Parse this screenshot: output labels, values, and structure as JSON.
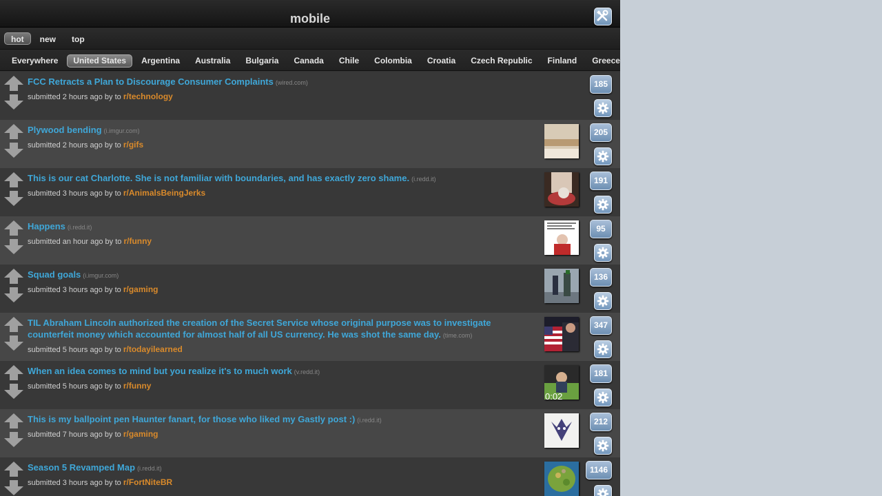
{
  "header": {
    "title": "mobile",
    "tools_icon": "tools-icon"
  },
  "sort_tabs": [
    {
      "label": "hot",
      "active": true
    },
    {
      "label": "new",
      "active": false
    },
    {
      "label": "top",
      "active": false
    }
  ],
  "countries": [
    {
      "label": "Everywhere",
      "active": false
    },
    {
      "label": "United States",
      "active": true
    },
    {
      "label": "Argentina",
      "active": false
    },
    {
      "label": "Australia",
      "active": false
    },
    {
      "label": "Bulgaria",
      "active": false
    },
    {
      "label": "Canada",
      "active": false
    },
    {
      "label": "Chile",
      "active": false
    },
    {
      "label": "Colombia",
      "active": false
    },
    {
      "label": "Croatia",
      "active": false
    },
    {
      "label": "Czech Republic",
      "active": false
    },
    {
      "label": "Finland",
      "active": false
    },
    {
      "label": "Greece",
      "active": false
    }
  ],
  "posts": [
    {
      "title": "FCC Retracts a Plan to Discourage Consumer Complaints",
      "domain": "(wired.com)",
      "meta": "submitted 2 hours ago  by to",
      "subreddit": "r/technology",
      "score": "185",
      "thumb": ""
    },
    {
      "title": "Plywood bending",
      "domain": "(i.imgur.com)",
      "meta": "submitted 2 hours ago  by to",
      "subreddit": "r/gifs",
      "score": "205",
      "thumb": "wood"
    },
    {
      "title": "This is our cat Charlotte. She is not familiar with boundaries, and has exactly zero shame.",
      "domain": "(i.redd.it)",
      "meta": "submitted 3 hours ago  by to",
      "subreddit": "r/AnimalsBeingJerks",
      "score": "191",
      "thumb": "cat"
    },
    {
      "title": "Happens",
      "domain": "(i.redd.it)",
      "meta": "submitted an hour ago  by to",
      "subreddit": "r/funny",
      "score": "95",
      "thumb": "meme"
    },
    {
      "title": "Squad goals",
      "domain": "(i.imgur.com)",
      "meta": "submitted 3 hours ago  by to",
      "subreddit": "r/gaming",
      "score": "136",
      "thumb": "squad"
    },
    {
      "title": "TIL Abraham Lincoln authorized the creation of the Secret Service whose original purpose was to investigate counterfeit money which accounted for almost half of all US currency. He was shot the same day.",
      "domain": "(time.com)",
      "meta": "submitted 5 hours ago  by to",
      "subreddit": "r/todayilearned",
      "score": "347",
      "thumb": "flag"
    },
    {
      "title": "When an idea comes to mind but you realize it's to much work",
      "domain": "(v.redd.it)",
      "meta": "submitted 5 hours ago  by to",
      "subreddit": "r/funny",
      "score": "181",
      "thumb": "video",
      "thumb_time": "0:02"
    },
    {
      "title": "This is my ballpoint pen Haunter fanart, for those who liked my Gastly post :)",
      "domain": "(i.redd.it)",
      "meta": "submitted 7 hours ago  by to",
      "subreddit": "r/gaming",
      "score": "212",
      "thumb": "haunter"
    },
    {
      "title": "Season 5 Revamped Map",
      "domain": "(i.redd.it)",
      "meta": "submitted 3 hours ago  by to",
      "subreddit": "r/FortNiteBR",
      "score": "1146",
      "thumb": "map"
    }
  ],
  "colors": {
    "title_link": "#3fa7d8",
    "subreddit": "#d98a2b",
    "button": "#7f9fc2"
  }
}
